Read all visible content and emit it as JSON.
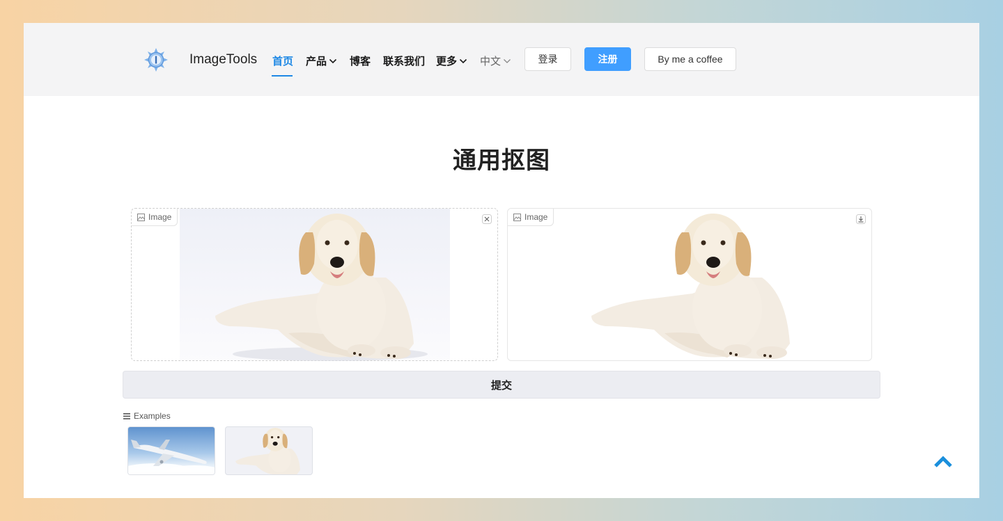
{
  "header": {
    "brand": "ImageTools",
    "nav": [
      {
        "label": "首页",
        "active": true
      },
      {
        "label": "产品",
        "dropdown": true
      },
      {
        "label": "博客"
      },
      {
        "label": "联系我们"
      },
      {
        "label": "更多",
        "dropdown": true
      }
    ],
    "language": "中文",
    "login_label": "登录",
    "register_label": "注册",
    "coffee_label": "By me a coffee"
  },
  "main": {
    "title": "通用抠图",
    "input_panel": {
      "label": "Image"
    },
    "output_panel": {
      "label": "Image"
    },
    "submit_label": "提交",
    "examples_label": "Examples"
  },
  "colors": {
    "accent": "#409eff",
    "active_nav": "#1e88e5",
    "scroll_top": "#1a8fdc"
  },
  "icons": [
    "logo-icon",
    "chevron-down-icon",
    "image-icon",
    "close-icon",
    "download-icon",
    "list-icon",
    "arrow-up-icon"
  ]
}
